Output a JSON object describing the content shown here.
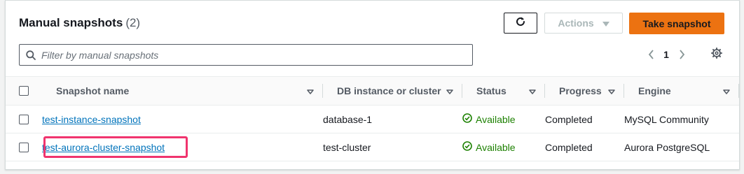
{
  "header": {
    "title": "Manual snapshots",
    "count": "(2)",
    "actions_label": "Actions",
    "primary_label": "Take snapshot"
  },
  "filter": {
    "placeholder": "Filter by manual snapshots",
    "value": ""
  },
  "pagination": {
    "current_page": "1"
  },
  "table": {
    "columns": [
      "Snapshot name",
      "DB instance or cluster",
      "Status",
      "Progress",
      "Engine"
    ],
    "rows": [
      {
        "name": "test-instance-snapshot",
        "instance": "database-1",
        "status": "Available",
        "progress": "Completed",
        "engine": "MySQL Community"
      },
      {
        "name": "test-aurora-cluster-snapshot",
        "instance": "test-cluster",
        "status": "Available",
        "progress": "Completed",
        "engine": "Aurora PostgreSQL"
      }
    ]
  },
  "icons": {
    "refresh": "refresh-icon",
    "search": "search-icon",
    "sort": "caret-down-icon",
    "status": "check-circle-icon",
    "settings": "gear-icon",
    "prev": "chevron-left-icon",
    "next": "chevron-right-icon"
  },
  "colors": {
    "primary": "#ec7211",
    "link": "#0073bb",
    "success": "#1d8102",
    "highlight": "#f0346e",
    "disabled": "#aab7b8"
  }
}
